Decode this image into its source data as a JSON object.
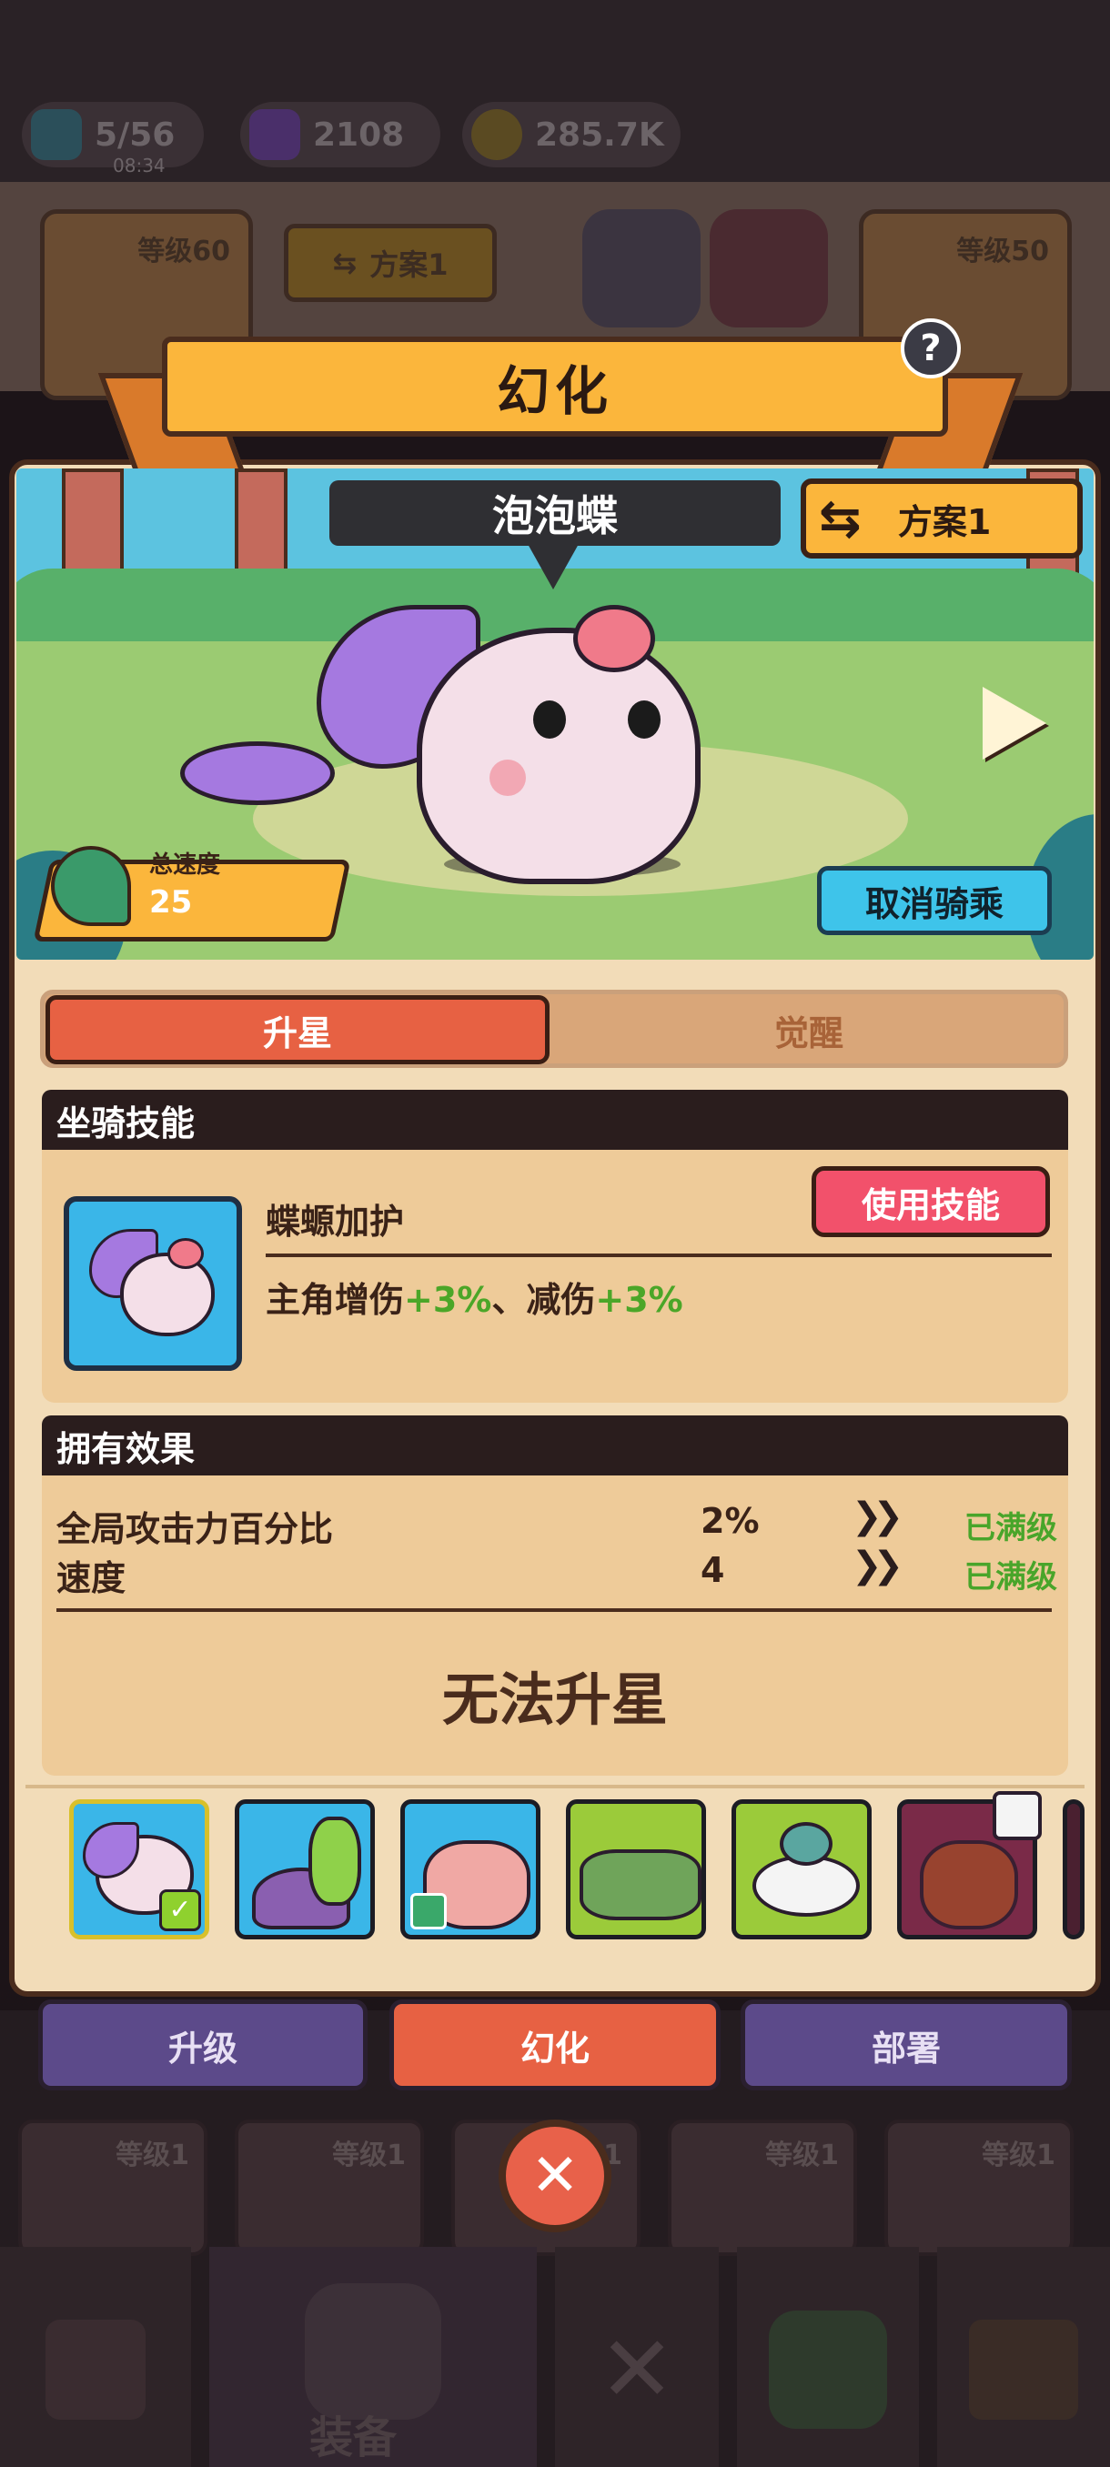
{
  "header": {
    "stamina": "5/56",
    "stamina_timer": "08:34",
    "gems": "2108",
    "coins": "285.7K"
  },
  "hero_row": {
    "left_level": "等级60",
    "scheme": "方案1",
    "right_level": "等级50"
  },
  "dialog": {
    "title": "幻化",
    "help_label": "?",
    "mount_name": "泡泡蝶",
    "scheme_button": "方案1",
    "speed_label": "总速度",
    "speed_value": "25",
    "unmount_button": "取消骑乘",
    "tabs": [
      {
        "label": "升星",
        "active": true
      },
      {
        "label": "觉醒",
        "active": false
      }
    ],
    "skill_section": {
      "title": "坐骑技能",
      "skill_name": "蝶螈加护",
      "desc_part1": "主角增伤",
      "desc_value1": "+3%",
      "desc_sep": "、减伤",
      "desc_value2": "+3%",
      "use_button": "使用技能"
    },
    "effects_section": {
      "title": "拥有效果",
      "rows": [
        {
          "name": "全局攻击力百分比",
          "value": "2%",
          "status": "已满级"
        },
        {
          "name": "速度",
          "value": "4",
          "status": "已满级"
        }
      ],
      "message": "无法升星"
    },
    "mounts": [
      {
        "name": "bubble-butterfly",
        "selected": true,
        "locked": false
      },
      {
        "name": "turtle-mount",
        "selected": false,
        "locked": false
      },
      {
        "name": "pig-mount",
        "selected": false,
        "locked": false
      },
      {
        "name": "crocodile-mount",
        "selected": false,
        "locked": false
      },
      {
        "name": "snail-mount",
        "selected": false,
        "locked": false
      },
      {
        "name": "moose-mount",
        "selected": false,
        "locked": true
      }
    ]
  },
  "bottom_tabs": [
    {
      "label": "升级",
      "active": false
    },
    {
      "label": "幻化",
      "active": true
    },
    {
      "label": "部署",
      "active": false
    }
  ],
  "equipment_row": [
    "等级1",
    "等级1",
    "等级1",
    "等级1",
    "等级1"
  ],
  "nav": {
    "equip_label": "装备"
  },
  "colors": {
    "orange": "#fbb63c",
    "red": "#e76143",
    "cyan": "#3ec4ea",
    "pink": "#f2516b",
    "green": "#4ba628",
    "purple": "#5c4a8a"
  }
}
